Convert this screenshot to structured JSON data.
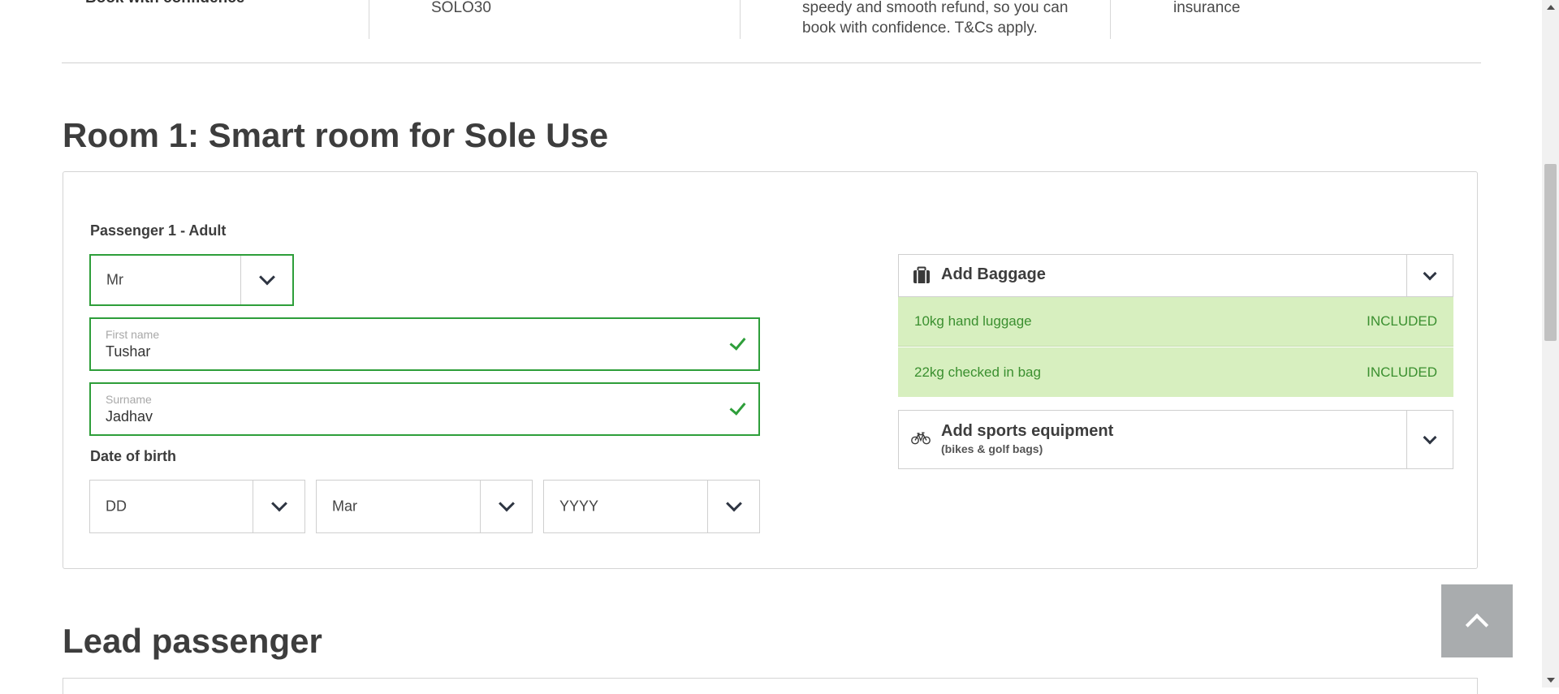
{
  "info_strip": {
    "col1": "Book with confidence",
    "col2": "SOLO30",
    "col3_line1": "speedy and smooth refund, so you can",
    "col3_line2": "book with confidence. T&Cs apply.",
    "col4": "insurance"
  },
  "room": {
    "title": "Room 1: Smart room for Sole Use",
    "passenger_label": "Passenger 1 - Adult",
    "title_select": "Mr",
    "first_name": {
      "label": "First name",
      "value": "Tushar"
    },
    "surname": {
      "label": "Surname",
      "value": "Jadhav"
    },
    "dob_label": "Date of birth",
    "dob": {
      "day": "DD",
      "month": "Mar",
      "year": "YYYY"
    }
  },
  "baggage": {
    "title": "Add Baggage",
    "icon": "suitcase-icon",
    "items": [
      {
        "name": "10kg hand luggage",
        "status": "INCLUDED"
      },
      {
        "name": "22kg checked in bag",
        "status": "INCLUDED"
      }
    ]
  },
  "sports": {
    "title": "Add sports equipment",
    "subtitle": "(bikes & golf bags)",
    "icon": "bicycle-icon"
  },
  "lead": {
    "title": "Lead passenger"
  },
  "colors": {
    "valid_green": "#2e9e3a",
    "included_bg": "#d7efbf",
    "included_text": "#3a8f2f"
  }
}
